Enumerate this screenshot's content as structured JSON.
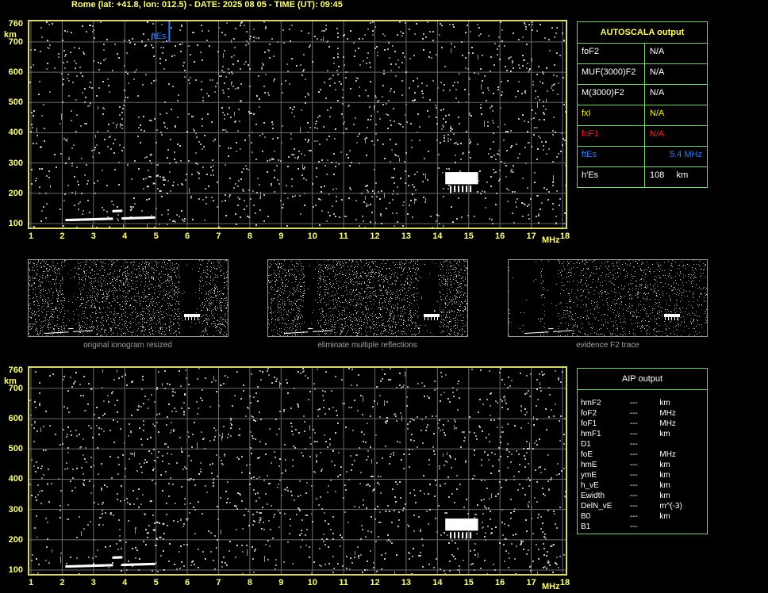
{
  "header": {
    "title": "Rome (lat: +41.8, lon: 012.5) - DATE: 2025 08 05 - TIME (UT): 09:45"
  },
  "main_plot": {
    "y_ticks": [
      "760",
      "700",
      "600",
      "500",
      "400",
      "300",
      "200",
      "100"
    ],
    "y_unit": "km",
    "x_ticks": [
      "1",
      "2",
      "3",
      "4",
      "5",
      "6",
      "7",
      "8",
      "9",
      "10",
      "11",
      "12",
      "13",
      "14",
      "15",
      "16",
      "17",
      "18"
    ],
    "x_unit": "MHz",
    "marker_label": "ftEs",
    "marker_freq_mhz": 5.4
  },
  "thumbnails": [
    {
      "caption": "original ionogram resized"
    },
    {
      "caption": "eliminate multiple reflections"
    },
    {
      "caption": "evidence F2 trace"
    }
  ],
  "autoscala": {
    "title": "AUTOSCALA output",
    "rows": [
      {
        "key": "foF2",
        "value": "N/A",
        "color": "#ffffff"
      },
      {
        "key": "MUF(3000)F2",
        "value": "N/A",
        "color": "#ffffff"
      },
      {
        "key": "M(3000)F2",
        "value": "N/A",
        "color": "#ffffff"
      },
      {
        "key": "fxI",
        "value": "N/A",
        "color": "#ffff00"
      },
      {
        "key": "foF1",
        "value": "N/A",
        "color": "#ff2020"
      },
      {
        "key": "ftEs",
        "value": "5.4 MHz",
        "color": "#2f7dff"
      },
      {
        "key": "h'Es",
        "value": "108     km",
        "color": "#ffffff"
      }
    ]
  },
  "aip": {
    "title": "AIP output",
    "rows": [
      {
        "key": "hmF2",
        "value": "---",
        "unit": "km"
      },
      {
        "key": "foF2",
        "value": "---",
        "unit": "MHz"
      },
      {
        "key": "foF1",
        "value": "---",
        "unit": "MHz"
      },
      {
        "key": "hmF1",
        "value": "---",
        "unit": "km"
      },
      {
        "key": "D1",
        "value": "---",
        "unit": ""
      },
      {
        "key": "foE",
        "value": "---",
        "unit": "MHz"
      },
      {
        "key": "hmE",
        "value": "---",
        "unit": "km"
      },
      {
        "key": "ymE",
        "value": "---",
        "unit": "km"
      },
      {
        "key": "h_vE",
        "value": "---",
        "unit": "km"
      },
      {
        "key": "Ewidth",
        "value": "---",
        "unit": "km"
      },
      {
        "key": "DelN_vE",
        "value": "---",
        "unit": "m^(-3)"
      },
      {
        "key": "B0",
        "value": "---",
        "unit": "km"
      },
      {
        "key": "B1",
        "value": "---",
        "unit": ""
      }
    ]
  }
}
